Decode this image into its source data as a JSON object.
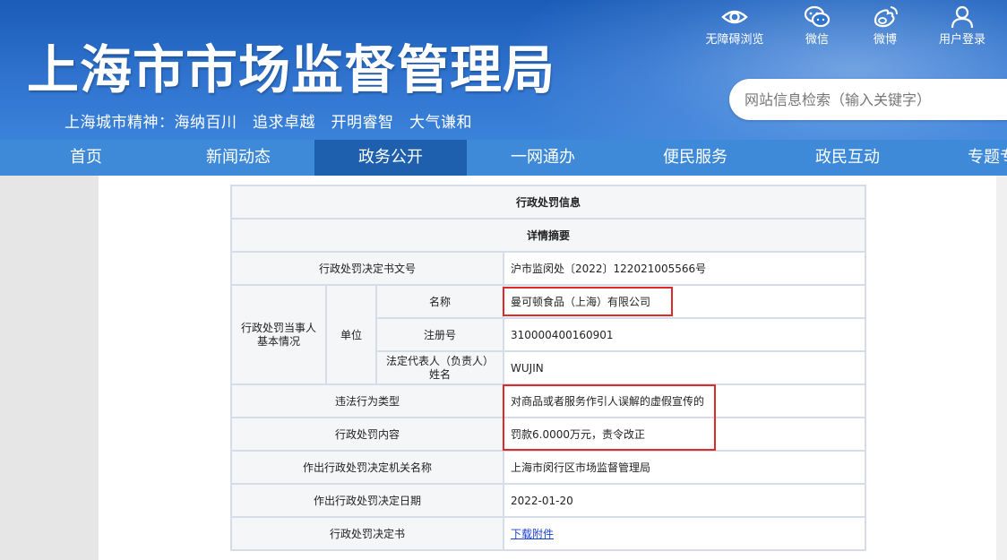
{
  "header": {
    "site_title": "上海市市场监督管理局",
    "slogan": "上海城市精神：海纳百川　追求卓越　开明睿智　大气谦和",
    "search_placeholder": "网站信息检索（输入关键字）",
    "top_links": [
      {
        "label": "无障碍浏览",
        "icon": "eye-icon"
      },
      {
        "label": "微信",
        "icon": "wechat-icon"
      },
      {
        "label": "微博",
        "icon": "weibo-icon"
      },
      {
        "label": "用户登录",
        "icon": "user-icon"
      }
    ]
  },
  "nav": {
    "items": [
      {
        "label": "首页"
      },
      {
        "label": "新闻动态"
      },
      {
        "label": "政务公开",
        "active": true
      },
      {
        "label": "一网通办"
      },
      {
        "label": "便民服务"
      },
      {
        "label": "政民互动"
      },
      {
        "label": "专题专栏"
      }
    ]
  },
  "table": {
    "title": "行政处罚信息",
    "subtitle": "详情摘要",
    "decision_no_label": "行政处罚决定书文号",
    "decision_no": "沪市监闵处〔2022〕122021005566号",
    "party_label": "行政处罚当事人基本情况",
    "unit_label": "单位",
    "name_label": "名称",
    "name_value": "曼可顿食品（上海）有限公司",
    "reg_label": "注册号",
    "reg_value": "310000400160901",
    "legal_rep_label": "法定代表人（负责人）姓名",
    "legal_rep_value": "WUJIN",
    "violation_label": "违法行为类型",
    "violation_value": "对商品或者服务作引人误解的虚假宣传的",
    "content_label": "行政处罚内容",
    "content_value": "罚款6.0000万元，责令改正",
    "authority_label": "作出行政处罚决定机关名称",
    "authority_value": "上海市闵行区市场监督管理局",
    "date_label": "作出行政处罚决定日期",
    "date_value": "2022-01-20",
    "doc_label": "行政处罚决定书",
    "doc_link": "下载附件"
  },
  "colors": {
    "header_blue": "#2f73cf",
    "nav_blue": "#3f8ad8",
    "nav_active": "#1e5fae",
    "highlight_red": "#e02a2a"
  }
}
